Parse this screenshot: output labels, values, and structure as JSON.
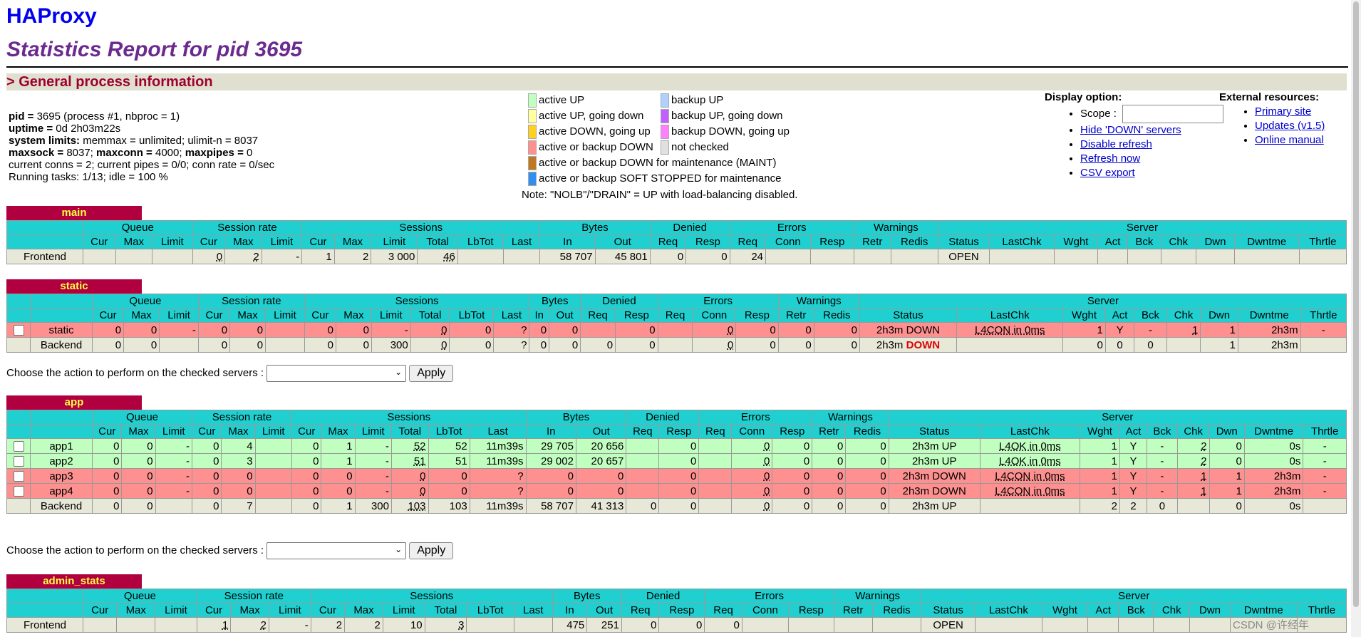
{
  "header": {
    "title": "HAProxy",
    "subtitle": "Statistics Report for pid 3695",
    "section": "> General process information"
  },
  "process": {
    "pid_label": "pid = ",
    "pid_value": "3695 (process #1, nbproc = 1)",
    "uptime_label": "uptime = ",
    "uptime_value": "0d 2h03m22s",
    "limits_label": "system limits:",
    "limits_value": " memmax = unlimited; ulimit-n = 8037",
    "maxsock_label": "maxsock = ",
    "maxsock_value": "8037; ",
    "maxconn_label": "maxconn = ",
    "maxconn_value": "4000; ",
    "maxpipes_label": "maxpipes = ",
    "maxpipes_value": "0",
    "conns": "current conns = 2; current pipes = 0/0; conn rate = 0/sec",
    "tasks": "Running tasks: 1/13; idle = 100 %"
  },
  "legend": {
    "items": [
      {
        "label": "active UP",
        "color": "#c0ffc0"
      },
      {
        "label": "backup UP",
        "color": "#b0d0ff"
      },
      {
        "label": "active UP, going down",
        "color": "#ffffa0"
      },
      {
        "label": "backup UP, going down",
        "color": "#c060ff"
      },
      {
        "label": "active DOWN, going up",
        "color": "#ffd020"
      },
      {
        "label": "backup DOWN, going up",
        "color": "#ff80ff"
      },
      {
        "label": "active or backup DOWN",
        "color": "#ff9090"
      },
      {
        "label": "not checked",
        "color": "#e0e0e0"
      },
      {
        "label": "active or backup DOWN for maintenance (MAINT)",
        "color": "#c07820"
      },
      {
        "label": "active or backup SOFT STOPPED for maintenance",
        "color": "#3090f0"
      }
    ],
    "note": "Note: \"NOLB\"/\"DRAIN\" = UP with load-balancing disabled."
  },
  "display_option": {
    "title": "Display option:",
    "scope_label": "Scope : ",
    "links": [
      "Hide 'DOWN' servers",
      "Disable refresh",
      "Refresh now",
      "CSV export"
    ]
  },
  "external": {
    "title": "External resources:",
    "links": [
      "Primary site",
      "Updates (v1.5)",
      "Online manual"
    ]
  },
  "headers": {
    "groups": [
      "Queue",
      "Session rate",
      "Sessions",
      "Bytes",
      "Denied",
      "Errors",
      "Warnings",
      "Server"
    ],
    "queue": [
      "Cur",
      "Max",
      "Limit"
    ],
    "rate": [
      "Cur",
      "Max",
      "Limit"
    ],
    "sessions": [
      "Cur",
      "Max",
      "Limit",
      "Total",
      "LbTot",
      "Last"
    ],
    "bytes": [
      "In",
      "Out"
    ],
    "denied": [
      "Req",
      "Resp"
    ],
    "errors": [
      "Req",
      "Conn",
      "Resp"
    ],
    "warnings": [
      "Retr",
      "Redis"
    ],
    "server": [
      "Status",
      "LastChk",
      "Wght",
      "Act",
      "Bck",
      "Chk",
      "Dwn",
      "Dwntme",
      "Thrtle"
    ]
  },
  "action": {
    "label": "Choose the action to perform on the checked servers : ",
    "apply": "Apply"
  },
  "proxies": {
    "main": {
      "name": "main",
      "rows": [
        {
          "cls": "frontend",
          "name": "Frontend",
          "checkbox": false,
          "cells": [
            "",
            "",
            "",
            "0",
            "2",
            "-",
            "1",
            "2",
            "3 000",
            "46",
            "",
            "",
            "58 707",
            "45 801",
            "0",
            "0",
            "24",
            "",
            "",
            "",
            "",
            "OPEN",
            "",
            "",
            "",
            "",
            "",
            "",
            "",
            ""
          ]
        }
      ]
    },
    "static": {
      "name": "static",
      "rows": [
        {
          "cls": "down",
          "name": "static",
          "checkbox": true,
          "cells": [
            "0",
            "0",
            "-",
            "0",
            "0",
            "",
            "0",
            "0",
            "-",
            "0",
            "0",
            "?",
            "0",
            "0",
            "",
            "0",
            "",
            "0",
            "0",
            "0",
            "0",
            "2h3m DOWN",
            "L4CON in 0ms",
            "1",
            "Y",
            "-",
            "1",
            "1",
            "2h3m",
            "-"
          ]
        },
        {
          "cls": "backend",
          "name": "Backend",
          "checkbox": false,
          "cells": [
            "0",
            "0",
            "",
            "0",
            "0",
            "",
            "0",
            "0",
            "300",
            "0",
            "0",
            "?",
            "0",
            "0",
            "0",
            "0",
            "",
            "0",
            "0",
            "0",
            "0",
            "2h3m DOWN",
            "",
            "0",
            "0",
            "0",
            "",
            "1",
            "2h3m",
            ""
          ]
        }
      ]
    },
    "app": {
      "name": "app",
      "rows": [
        {
          "cls": "up",
          "name": "app1",
          "checkbox": true,
          "cells": [
            "0",
            "0",
            "-",
            "0",
            "4",
            "",
            "0",
            "1",
            "-",
            "52",
            "52",
            "11m39s",
            "29 705",
            "20 656",
            "",
            "0",
            "",
            "0",
            "0",
            "0",
            "0",
            "2h3m UP",
            "L4OK in 0ms",
            "1",
            "Y",
            "-",
            "2",
            "0",
            "0s",
            "-"
          ]
        },
        {
          "cls": "up",
          "name": "app2",
          "checkbox": true,
          "cells": [
            "0",
            "0",
            "-",
            "0",
            "3",
            "",
            "0",
            "1",
            "-",
            "51",
            "51",
            "11m39s",
            "29 002",
            "20 657",
            "",
            "0",
            "",
            "0",
            "0",
            "0",
            "0",
            "2h3m UP",
            "L4OK in 0ms",
            "1",
            "Y",
            "-",
            "2",
            "0",
            "0s",
            "-"
          ]
        },
        {
          "cls": "down",
          "name": "app3",
          "checkbox": true,
          "cells": [
            "0",
            "0",
            "-",
            "0",
            "0",
            "",
            "0",
            "0",
            "-",
            "0",
            "0",
            "?",
            "0",
            "0",
            "",
            "0",
            "",
            "0",
            "0",
            "0",
            "0",
            "2h3m DOWN",
            "L4CON in 0ms",
            "1",
            "Y",
            "-",
            "1",
            "1",
            "2h3m",
            "-"
          ]
        },
        {
          "cls": "down",
          "name": "app4",
          "checkbox": true,
          "cells": [
            "0",
            "0",
            "-",
            "0",
            "0",
            "",
            "0",
            "0",
            "-",
            "0",
            "0",
            "?",
            "0",
            "0",
            "",
            "0",
            "",
            "0",
            "0",
            "0",
            "0",
            "2h3m DOWN",
            "L4CON in 0ms",
            "1",
            "Y",
            "-",
            "1",
            "1",
            "2h3m",
            "-"
          ]
        },
        {
          "cls": "backend",
          "name": "Backend",
          "checkbox": false,
          "cells": [
            "0",
            "0",
            "",
            "0",
            "7",
            "",
            "0",
            "1",
            "300",
            "103",
            "103",
            "11m39s",
            "58 707",
            "41 313",
            "0",
            "0",
            "",
            "0",
            "0",
            "0",
            "0",
            "2h3m UP",
            "",
            "2",
            "2",
            "0",
            "",
            "0",
            "0s",
            ""
          ]
        }
      ]
    },
    "admin_stats": {
      "name": "admin_stats",
      "rows": [
        {
          "cls": "frontend",
          "name": "Frontend",
          "checkbox": false,
          "cells": [
            "",
            "",
            "",
            "1",
            "2",
            "-",
            "2",
            "2",
            "10",
            "3",
            "",
            "",
            "475",
            "251",
            "0",
            "0",
            "0",
            "",
            "",
            "",
            "",
            "OPEN",
            "",
            "",
            "",
            "",
            "",
            "",
            "",
            ""
          ]
        }
      ]
    }
  },
  "watermark": "CSDN @许经年"
}
